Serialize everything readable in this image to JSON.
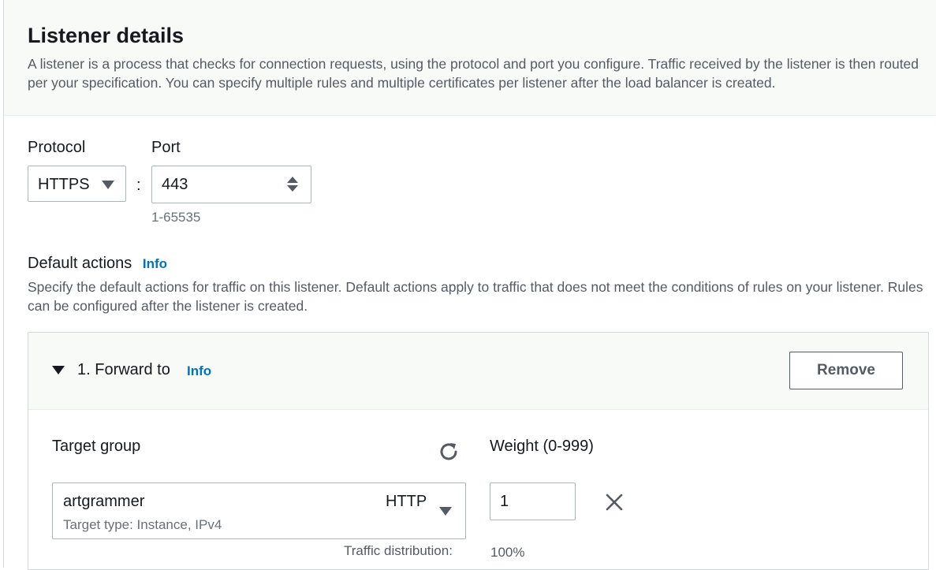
{
  "listener": {
    "title": "Listener details",
    "description": "A listener is a process that checks for connection requests, using the protocol and port you configure. Traffic received by the listener is then routed per your specification. You can specify multiple rules and multiple certificates per listener after the load balancer is created.",
    "protocol_label": "Protocol",
    "protocol_value": "HTTPS",
    "separator": ":",
    "port_label": "Port",
    "port_value": "443",
    "port_hint": "1-65535"
  },
  "default_actions": {
    "heading": "Default actions",
    "info_link": "Info",
    "description": "Specify the default actions for traffic on this listener. Default actions apply to traffic that does not meet the conditions of rules on your listener. Rules can be configured after the listener is created.",
    "action": {
      "title": "1. Forward to",
      "info_link": "Info",
      "remove_label": "Remove",
      "target_group_label": "Target group",
      "weight_label": "Weight (0-999)",
      "target_group": {
        "name": "artgrammer",
        "protocol": "HTTP",
        "type": "Target type: Instance, IPv4"
      },
      "weight_value": "1",
      "traffic_distribution_label": "Traffic distribution:",
      "traffic_distribution_value": "100%"
    }
  },
  "icons": {
    "refresh": "refresh-icon",
    "remove": "close-icon",
    "caret": "caret-down-icon",
    "expand": "triangle-down-icon"
  },
  "colors": {
    "link": "#0073bb",
    "header_bg": "#f8faf8",
    "border": "#aab7b8",
    "text": "#16191f",
    "muted": "#545b64"
  }
}
